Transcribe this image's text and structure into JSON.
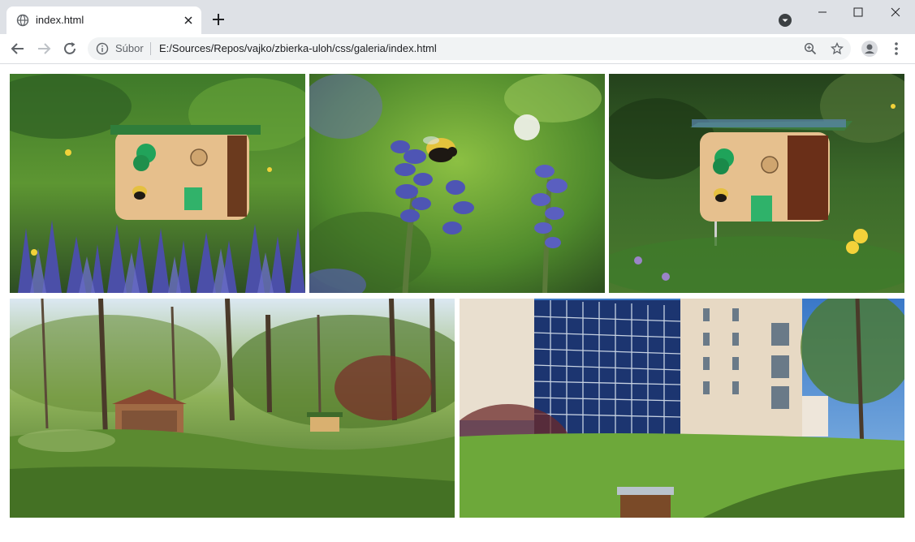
{
  "browser": {
    "tab_title": "index.html",
    "chip_label": "Súbor",
    "url": "E:/Sources/Repos/vajko/zbierka-uloh/css/galeria/index.html"
  },
  "gallery": {
    "photos": [
      {
        "subject": "bee-house-in-bugle-flowers"
      },
      {
        "subject": "bumblebee-on-bugle-flower"
      },
      {
        "subject": "bee-house-in-meadow"
      },
      {
        "subject": "park-with-gazebo-and-bee-house"
      },
      {
        "subject": "university-building-with-bee-house"
      }
    ]
  },
  "colors": {
    "tabstrip": "#dee1e6",
    "omnibox": "#f1f3f4",
    "accent_green": "#2e7d32"
  }
}
